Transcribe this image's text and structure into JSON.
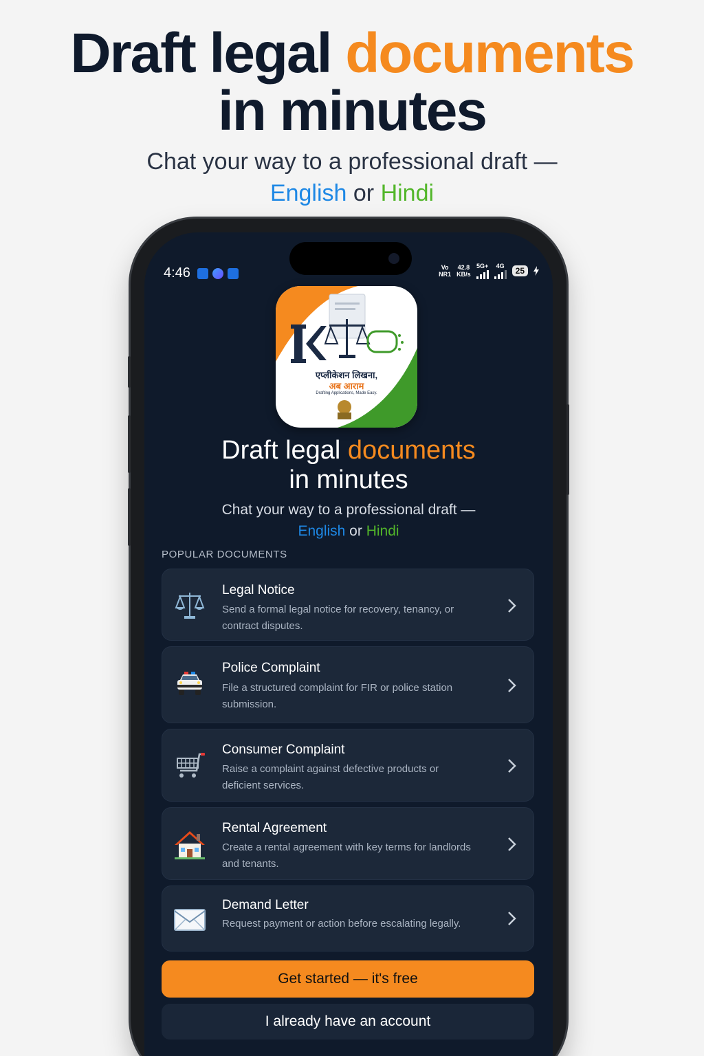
{
  "hero": {
    "title_part1": "Draft legal ",
    "title_accent": "documents",
    "title_line2": "in minutes",
    "subtitle_line1": "Chat your way to a professional draft —",
    "lang_english": "English",
    "lang_or": " or ",
    "lang_hindi": "Hindi"
  },
  "status_bar": {
    "time": "4:46",
    "net_label_top": "Vo",
    "net_label_bottom": "NR1",
    "speed_value": "42.8",
    "speed_unit": "KB/s",
    "net1": "5G+",
    "net2": "4G",
    "battery": "25"
  },
  "logo": {
    "hindi_line1": "एप्लीकेशन लिखना,",
    "hindi_line2": "अब आराम",
    "tagline": "Drafting Applications, Made Easy."
  },
  "screen": {
    "title_part1": "Draft legal ",
    "title_accent": "documents",
    "title_line2": "in minutes",
    "subtitle_line1": "Chat your way to a professional draft —",
    "lang_english": "English",
    "lang_or": " or ",
    "lang_hindi": "Hindi",
    "section_label": "POPULAR DOCUMENTS"
  },
  "documents": [
    {
      "title": "Legal Notice",
      "desc": "Send a formal legal notice for recovery, tenancy, or contract disputes.",
      "icon": "scales-icon"
    },
    {
      "title": "Police Complaint",
      "desc": "File a structured complaint for FIR or police station submission.",
      "icon": "police-car-icon"
    },
    {
      "title": "Consumer Complaint",
      "desc": "Raise a complaint against defective products or deficient services.",
      "icon": "shopping-cart-icon"
    },
    {
      "title": "Rental Agreement",
      "desc": "Create a rental agreement with key terms for landlords and tenants.",
      "icon": "house-icon"
    },
    {
      "title": "Demand Letter",
      "desc": "Request payment or action before escalating legally.",
      "icon": "envelope-icon"
    }
  ],
  "actions": {
    "primary": "Get started — it's free",
    "secondary": "I already have an account"
  },
  "colors": {
    "accent": "#f58a1f",
    "english": "#1e88e5",
    "hindi": "#52b62a",
    "screen_bg": "#0f1a2b",
    "card_bg": "#1c2839"
  }
}
